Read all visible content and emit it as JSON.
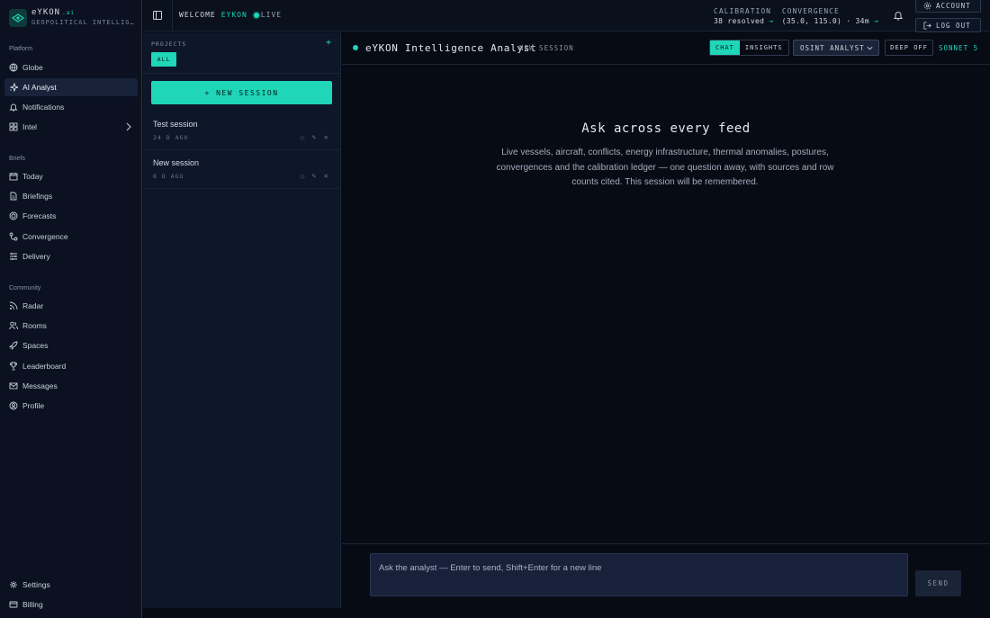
{
  "brand": {
    "name": "eYKON",
    "sup": ".ai",
    "subtitle": "GEOPOLITICAL INTELLIG…"
  },
  "nav": {
    "sections": {
      "platform": "Platform",
      "briefs": "Briefs",
      "community": "Community"
    },
    "platform": [
      {
        "label": "Globe",
        "icon": "globe-icon"
      },
      {
        "label": "AI Analyst",
        "icon": "sparkle-icon",
        "active": true
      },
      {
        "label": "Notifications",
        "icon": "bell-icon"
      },
      {
        "label": "Intel",
        "icon": "grid-icon"
      }
    ],
    "briefs": [
      {
        "label": "Today",
        "icon": "calendar-icon"
      },
      {
        "label": "Briefings",
        "icon": "document-icon"
      },
      {
        "label": "Forecasts",
        "icon": "target-icon"
      },
      {
        "label": "Convergence",
        "icon": "convergence-icon"
      },
      {
        "label": "Delivery",
        "icon": "delivery-icon"
      }
    ],
    "community": [
      {
        "label": "Radar",
        "icon": "rss-icon"
      },
      {
        "label": "Rooms",
        "icon": "users-icon"
      },
      {
        "label": "Spaces",
        "icon": "rocket-icon"
      },
      {
        "label": "Leaderboard",
        "icon": "trophy-icon"
      },
      {
        "label": "Messages",
        "icon": "mail-icon"
      },
      {
        "label": "Profile",
        "icon": "profile-icon"
      }
    ],
    "footer": [
      {
        "label": "Settings",
        "icon": "gear-icon"
      },
      {
        "label": "Billing",
        "icon": "card-icon"
      }
    ]
  },
  "topbar": {
    "welcome": "WELCOME",
    "user": "EYKON",
    "live": "LIVE",
    "calibration_label": "CALIBRATION",
    "convergence_label": "CONVERGENCE",
    "calibration_value": "38 resolved",
    "convergence_value": "(35.0, 115.0) · 34m",
    "arrow": "→",
    "account": "ACCOUNT",
    "logout": "LOG OUT"
  },
  "projects": {
    "label": "PROJECTS",
    "add": "+",
    "filter": "ALL",
    "new_session": "+ NEW SESSION",
    "sessions": [
      {
        "title": "Test session",
        "meta": "24 D AGO",
        "actions": "◇ ✎ ✕"
      },
      {
        "title": "New session",
        "meta": "8 D AGO",
        "actions": "◇ ✎ ✕"
      }
    ]
  },
  "main": {
    "title": "eYKON Intelligence Analyst",
    "subtitle": "NEW SESSION",
    "tabs": {
      "chat": "CHAT",
      "insights": "INSIGHTS"
    },
    "persona": "OSINT ANALYST",
    "deep": "DEEP OFF",
    "model": "SONNET 5",
    "empty_title": "Ask across every feed",
    "empty_desc": "Live vessels, aircraft, conflicts, energy infrastructure, thermal anomalies, postures, convergences and the calibration ledger — one question away, with sources and row counts cited. This session will be remembered.",
    "composer_placeholder": "Ask the analyst — Enter to send, Shift+Enter for a new line",
    "send": "SEND"
  },
  "colors": {
    "accent": "#1fd6b8",
    "bg": "#070b14",
    "panel": "#0e1629",
    "nav": "#0b1120"
  }
}
